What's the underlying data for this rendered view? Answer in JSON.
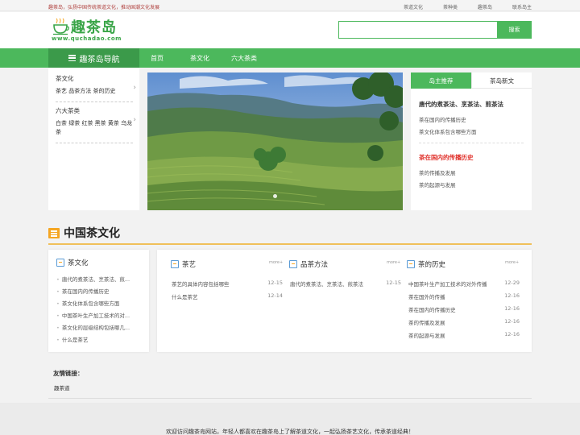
{
  "topbar": {
    "tagline": "趣茶岛，弘扬中国传统茶道文化，推动国潮文化发展",
    "links": [
      "茶道文化",
      "茶种类",
      "趣茶岛",
      "联系岛主"
    ]
  },
  "logo": {
    "name": "趣茶岛",
    "url": "www.quchadao.com"
  },
  "search": {
    "placeholder": "",
    "button": "搜索"
  },
  "nav": {
    "home": "趣茶岛导航",
    "items": [
      "首页",
      "茶文化",
      "六大茶类"
    ]
  },
  "sidebar": {
    "groups": [
      {
        "title": "茶文化",
        "sub": "茶艺  品茶方法  茶的历史"
      },
      {
        "title": "六大茶类",
        "sub": "白茶  绿茶  红茶  黑茶  黄茶  乌龙茶"
      }
    ]
  },
  "recommend": {
    "tabs": [
      "岛主推荐",
      "茶岛新文"
    ],
    "head1": "唐代的煮茶法、烹茶法、煎茶法",
    "links1": [
      "茶在国内的传播历史",
      "茶文化体系包含哪些方面"
    ],
    "head2": "茶在国内的传播历史",
    "links2": [
      "茶的传播及发展",
      "茶的起源与发展"
    ]
  },
  "section": {
    "title": "中国茶文化"
  },
  "cards": {
    "culture": {
      "title": "茶文化",
      "items": [
        "唐代的煮茶法、烹茶法、煎...",
        "茶在国内的传播历史",
        "茶文化体系包含哪些方面",
        "中国茶叶生产加工技术的对...",
        "茶文化的层级结构包括哪几...",
        "什么是茶艺"
      ]
    },
    "art": {
      "title": "茶艺",
      "more": "more+",
      "items": [
        {
          "text": "茶艺的具体内容包括哪些",
          "date": "12-15"
        },
        {
          "text": "什么是茶艺",
          "date": "12-14"
        }
      ]
    },
    "method": {
      "title": "品茶方法",
      "more": "more+",
      "items": [
        {
          "text": "唐代的煮茶法、烹茶法、煎茶法",
          "date": "12-15"
        }
      ]
    },
    "history": {
      "title": "茶的历史",
      "more": "more+",
      "items": [
        {
          "text": "中国茶叶生产加工技术的对外传播",
          "date": "12-29"
        },
        {
          "text": "茶在国外的传播",
          "date": "12-16"
        },
        {
          "text": "茶在国内的传播历史",
          "date": "12-16"
        },
        {
          "text": "茶的传播及发展",
          "date": "12-16"
        },
        {
          "text": "茶的起源与发展",
          "date": "12-16"
        }
      ]
    }
  },
  "friends": {
    "title": "友情链接：",
    "links": [
      "趣茶道"
    ]
  },
  "footer": {
    "text": "欢迎访问趣茶岛网站，年轻人都喜欢在趣茶岛上了解茶道文化，一起弘扬茶艺文化，传承茶道经典！"
  },
  "colors": {
    "accent": "#4cb85c",
    "accent_dark": "#3b9a4a",
    "highlight": "#e0302a",
    "tagline": "#b0413e",
    "divider": "#f0c05a"
  }
}
